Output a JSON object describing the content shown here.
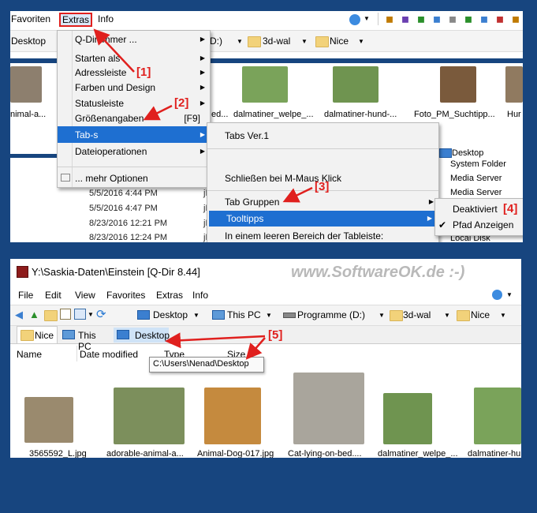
{
  "top": {
    "menu": {
      "favorites": "Favoriten",
      "extras": "Extras",
      "info": "Info"
    },
    "toolbar": {
      "desktop": "Desktop",
      "drive": "D:)",
      "folder1": "3d-wal",
      "folder2": "Nice"
    },
    "extras_menu": [
      {
        "label": "Q-Dir immer ...",
        "arrow": true
      },
      {
        "label": "Starten als",
        "arrow": true
      },
      {
        "label": "Adressleiste",
        "arrow": true
      },
      {
        "label": "Farben und Design",
        "arrow": true
      },
      {
        "label": "Statusleiste",
        "arrow": true
      },
      {
        "label": "Größenangaben",
        "shortcut": "[F9]"
      },
      {
        "label": "Tab-s",
        "arrow": true,
        "highlight": true
      },
      {
        "label": "Dateioperationen",
        "arrow": true
      },
      {
        "label": "... mehr Optionen"
      }
    ],
    "tabs_submenu": [
      {
        "label": "Tabs Ver.1"
      },
      {
        "label": "Schließen bei M-Maus Klick"
      },
      {
        "label": "Tab Gruppen",
        "arrow": true
      },
      {
        "label": "Tooltipps",
        "arrow": true,
        "highlight": true
      },
      {
        "label": "In einem leeren Bereich der Tableiste:"
      }
    ],
    "tooltip_submenu": [
      {
        "label": "Deaktiviert"
      },
      {
        "label": "Pfad Anzeigen",
        "checked": true
      }
    ],
    "thumbs": [
      "nimal-a...",
      "ed...",
      "dalmatiner_welpe_...",
      "dalmatiner-hund-...",
      "Foto_PM_Suchtipp...",
      "Hur"
    ],
    "right_list": [
      "Desktop",
      "System Folder",
      "Media Server",
      "Media Server",
      "Local Disk"
    ],
    "dates": [
      "5/5/2016 4:44 PM",
      "5/5/2016 4:47 PM",
      "8/23/2016 12:21 PM",
      "8/23/2016 12:24 PM"
    ],
    "date_suffix": [
      "jF",
      "jF",
      "jF",
      "jF"
    ]
  },
  "bottom": {
    "title": "Y:\\Saskia-Daten\\Einstein  [Q-Dir 8.44]",
    "watermark": "www.SoftwareOK.de :-)",
    "menu": {
      "file": "File",
      "edit": "Edit",
      "view": "View",
      "favorites": "Favorites",
      "extras": "Extras",
      "info": "Info"
    },
    "address": {
      "desktop": "Desktop",
      "thispc": "This PC",
      "programs": "Programme (D:)",
      "folder1": "3d-wal",
      "folder2": "Nice"
    },
    "tabs": {
      "nice": "Nice",
      "thispc": "This PC",
      "desktop": "Desktop"
    },
    "columns": {
      "name": "Name",
      "date": "Date modified",
      "type": "Type",
      "size": "Size"
    },
    "tooltip": "C:\\Users\\Nenad\\Desktop",
    "files": [
      "3565592_L.jpg",
      "adorable-animal-a...",
      "Animal-Dog-017.jpg",
      "Cat-lying-on-bed....",
      "dalmatiner_welpe_...",
      "dalmatiner-hu"
    ]
  },
  "annotations": [
    "[1]",
    "[2]",
    "[3]",
    "[4]",
    "[5]"
  ],
  "colors": {
    "accent": "#e0201e",
    "highlight": "#1e6fd1",
    "frame": "#17457f"
  }
}
